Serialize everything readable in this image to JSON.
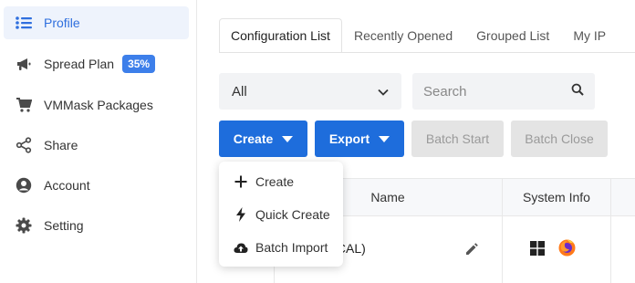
{
  "sidebar": {
    "items": [
      {
        "label": "Profile",
        "icon": "list-icon",
        "active": true
      },
      {
        "label": "Spread Plan",
        "icon": "megaphone-icon",
        "badge": "35%"
      },
      {
        "label": "VMMask Packages",
        "icon": "cart-icon"
      },
      {
        "label": "Share",
        "icon": "share-icon"
      },
      {
        "label": "Account",
        "icon": "user-icon"
      },
      {
        "label": "Setting",
        "icon": "gear-icon"
      }
    ]
  },
  "tabs": [
    "Configuration List",
    "Recently Opened",
    "Grouped List",
    "My IP"
  ],
  "filter": {
    "selected": "All",
    "search_placeholder": "Search"
  },
  "toolbar": {
    "create_label": "Create",
    "export_label": "Export",
    "batch_start_label": "Batch Start",
    "batch_close_label": "Batch Close"
  },
  "table": {
    "headers": {
      "name": "Name",
      "system_info": "System Info"
    },
    "rows": [
      {
        "name_visible": "OCAL)",
        "os": [
          "windows-icon",
          "firefox-icon"
        ]
      }
    ]
  },
  "create_menu": {
    "items": [
      {
        "label": "Create",
        "icon": "plus-icon"
      },
      {
        "label": "Quick Create",
        "icon": "bolt-icon"
      },
      {
        "label": "Batch Import",
        "icon": "cloud-upload-icon"
      }
    ]
  },
  "colors": {
    "accent": "#1e6ddc",
    "badge": "#3d7fea",
    "active_bg": "#eef3fc"
  }
}
